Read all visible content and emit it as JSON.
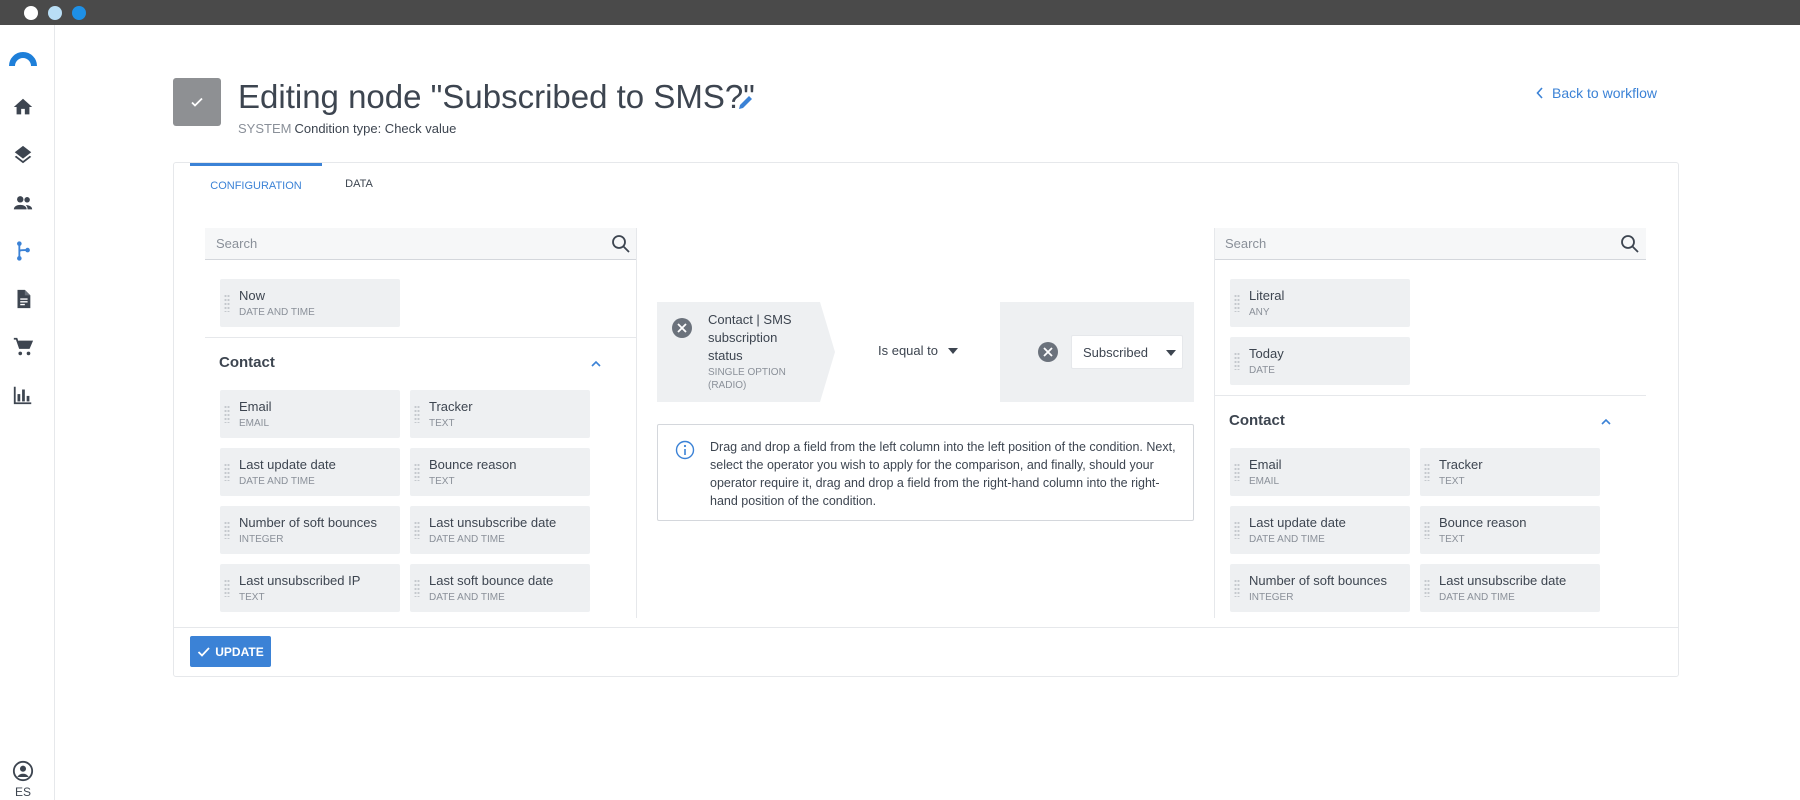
{
  "window": {
    "controls": [
      "close",
      "minimize",
      "maximize"
    ]
  },
  "sidebar": {
    "items": [
      {
        "icon": "home-icon"
      },
      {
        "icon": "layers-icon"
      },
      {
        "icon": "contacts-icon"
      },
      {
        "icon": "workflow-icon",
        "active": true
      },
      {
        "icon": "document-icon"
      },
      {
        "icon": "cart-icon"
      },
      {
        "icon": "chart-icon"
      }
    ],
    "user_icon": "account-icon",
    "language": "ES"
  },
  "header": {
    "title": "Editing node \"Subscribed to SMS?\"",
    "system_label": "SYSTEM",
    "subtitle": "Condition type: Check value",
    "back_label": "Back to workflow"
  },
  "tabs": [
    {
      "label": "CONFIGURATION",
      "active": true
    },
    {
      "label": "DATA",
      "active": false
    }
  ],
  "left_panel": {
    "search_placeholder": "Search",
    "top_fields": [
      {
        "label": "Now",
        "type": "DATE AND TIME"
      }
    ],
    "section": {
      "title": "Contact",
      "fields": [
        {
          "label": "Email",
          "type": "EMAIL"
        },
        {
          "label": "Tracker",
          "type": "TEXT"
        },
        {
          "label": "Last update date",
          "type": "DATE AND TIME"
        },
        {
          "label": "Bounce reason",
          "type": "TEXT"
        },
        {
          "label": "Number of soft bounces",
          "type": "INTEGER"
        },
        {
          "label": "Last unsubscribe date",
          "type": "DATE AND TIME"
        },
        {
          "label": "Last unsubscribed IP",
          "type": "TEXT"
        },
        {
          "label": "Last soft bounce date",
          "type": "DATE AND TIME"
        }
      ]
    }
  },
  "condition": {
    "field": "Contact | SMS subscription status",
    "field_type": "SINGLE OPTION (RADIO)",
    "operator": "Is equal to",
    "value": "Subscribed"
  },
  "info_text": "Drag and drop a field from the left column into the left position of the condition. Next, select the operator you wish to apply for the comparison, and finally, should your operator require it, drag and drop a field from the right-hand column into the right-hand position of the condition.",
  "right_panel": {
    "search_placeholder": "Search",
    "top_fields": [
      {
        "label": "Literal",
        "type": "ANY"
      },
      {
        "label": "Today",
        "type": "DATE"
      }
    ],
    "section": {
      "title": "Contact",
      "fields": [
        {
          "label": "Email",
          "type": "EMAIL"
        },
        {
          "label": "Tracker",
          "type": "TEXT"
        },
        {
          "label": "Last update date",
          "type": "DATE AND TIME"
        },
        {
          "label": "Bounce reason",
          "type": "TEXT"
        },
        {
          "label": "Number of soft bounces",
          "type": "INTEGER"
        },
        {
          "label": "Last unsubscribe date",
          "type": "DATE AND TIME"
        }
      ]
    }
  },
  "footer": {
    "update_label": "UPDATE"
  },
  "colors": {
    "accent": "#3b82d6",
    "chip_bg": "#eef0f2",
    "text": "#3d4550",
    "muted": "#8a9099",
    "titlebar": "#4a4a4a"
  }
}
